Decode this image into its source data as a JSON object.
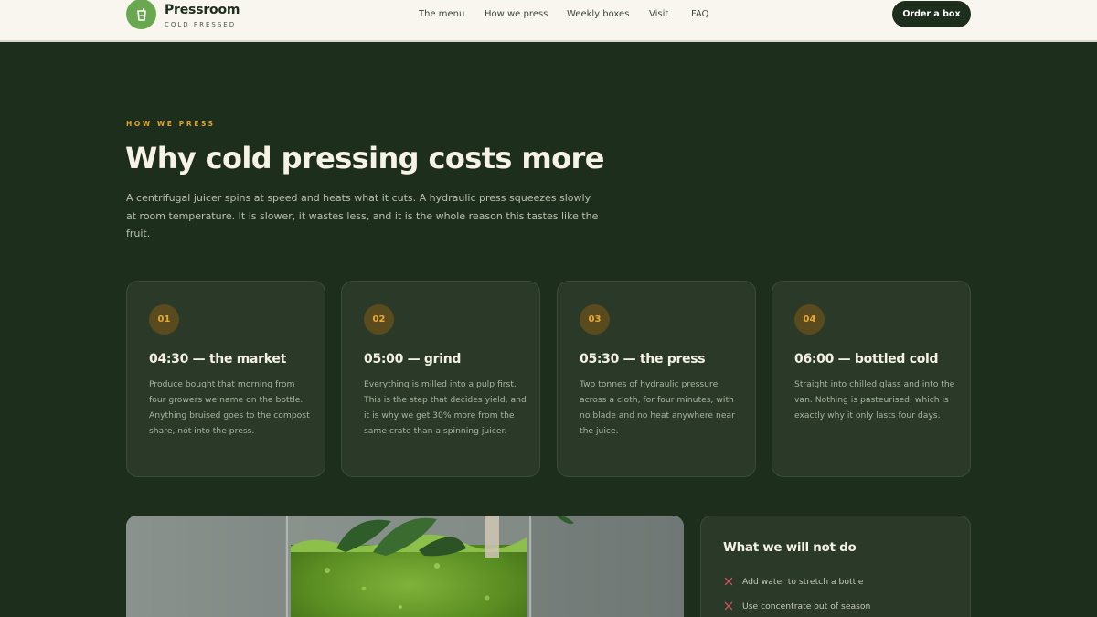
{
  "header": {
    "brand": "Pressroom",
    "tagline": "COLD PRESSED",
    "nav": [
      "The menu",
      "How we press",
      "Weekly boxes",
      "Visit",
      "FAQ"
    ],
    "cta_label": "Order a box"
  },
  "hero": {
    "eyebrow": "HOW WE PRESS",
    "title": "Why cold pressing costs more",
    "lede": "A centrifugal juicer spins at speed and heats what it cuts. A hydraulic press squeezes slowly at room temperature. It is slower, it wastes less, and it is the whole reason this tastes like the fruit."
  },
  "steps": [
    {
      "num": "01",
      "title": "04:30 — the market",
      "body": "Produce bought that morning from four growers we name on the bottle. Anything bruised goes to the compost share, not into the press."
    },
    {
      "num": "02",
      "title": "05:00 — grind",
      "body": "Everything is milled into a pulp first. This is the step that decides yield, and it is why we get 30% more from the same crate than a spinning juicer."
    },
    {
      "num": "03",
      "title": "05:30 — the press",
      "body": "Two tonnes of hydraulic pressure across a cloth, for four minutes, with no blade and no heat anywhere near the juice."
    },
    {
      "num": "04",
      "title": "06:00 — bottled cold",
      "body": "Straight into chilled glass and into the van. Nothing is pasteurised, which is exactly why it only lasts four days."
    }
  ],
  "not_do": {
    "title": "What we will not do",
    "items": [
      "Add water to stretch a bottle",
      "Use concentrate out of season"
    ]
  },
  "colors": {
    "background": "#1e2e1c",
    "header_bg": "#f8f6ee",
    "accent": "#e0a62c",
    "brand_green": "#6aa84f",
    "card_bg": "#2b3a28",
    "x_mark": "#c9535a"
  }
}
